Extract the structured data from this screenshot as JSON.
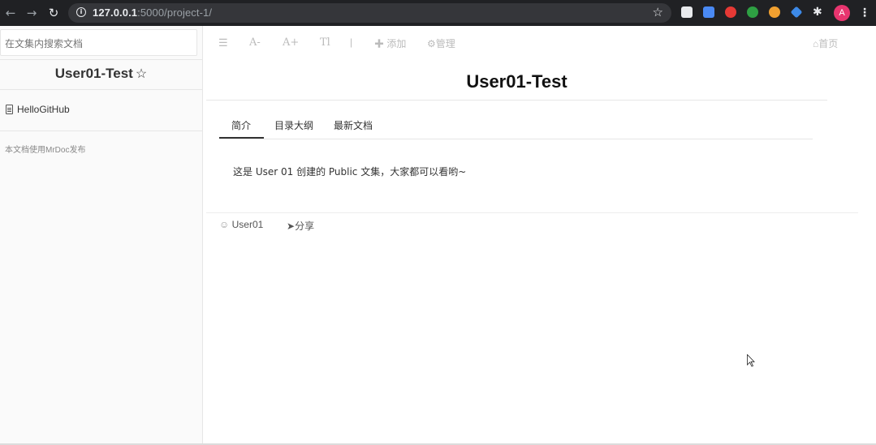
{
  "browser": {
    "url_host": "127.0.0.1",
    "url_rest": ":5000/project-1/",
    "avatar_letter": "A"
  },
  "sidebar": {
    "search_placeholder": "在文集内搜索文档",
    "title": "User01-Test",
    "docs": [
      {
        "label": "HelloGitHub"
      }
    ],
    "footer": "本文档使用MrDoc发布"
  },
  "toolbar": {
    "add_label": "添加",
    "manage_label": "管理",
    "home_label": "首页",
    "font_decrease": "A-",
    "font_increase": "A+",
    "font_type": "Tl",
    "separator": "|"
  },
  "main": {
    "title": "User01-Test",
    "tabs": [
      {
        "label": "简介"
      },
      {
        "label": "目录大纲"
      },
      {
        "label": "最新文档"
      }
    ],
    "intro": "这是 User 01 创建的 Public 文集，大家都可以看哟~",
    "author": "User01",
    "share_label": "分享"
  }
}
